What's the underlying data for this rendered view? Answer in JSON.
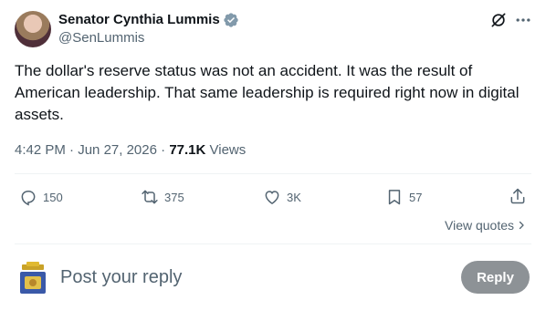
{
  "author": {
    "name": "Senator Cynthia Lummis",
    "handle": "@SenLummis"
  },
  "tweet": {
    "text": "The dollar's reserve status was not an accident. It was the result of American leadership. That same leadership is required right now in digital assets.",
    "time": "4:42 PM",
    "date": "Jun 27, 2026",
    "views_count": "77.1K",
    "views_label": "Views"
  },
  "actions": {
    "replies": "150",
    "reposts": "375",
    "likes": "3K",
    "bookmarks": "57"
  },
  "view_quotes_label": "View quotes",
  "composer": {
    "placeholder": "Post your reply",
    "reply_label": "Reply"
  },
  "icons": {
    "verified": "verified-badge-icon",
    "grok": "grok-icon",
    "more": "more-icon",
    "reply": "reply-icon",
    "repost": "repost-icon",
    "like": "heart-icon",
    "bookmark": "bookmark-icon",
    "share": "share-icon"
  },
  "colors": {
    "text": "#0f1419",
    "secondary": "#536471",
    "verified": "#829aab",
    "reply_button": "#8d9296"
  }
}
